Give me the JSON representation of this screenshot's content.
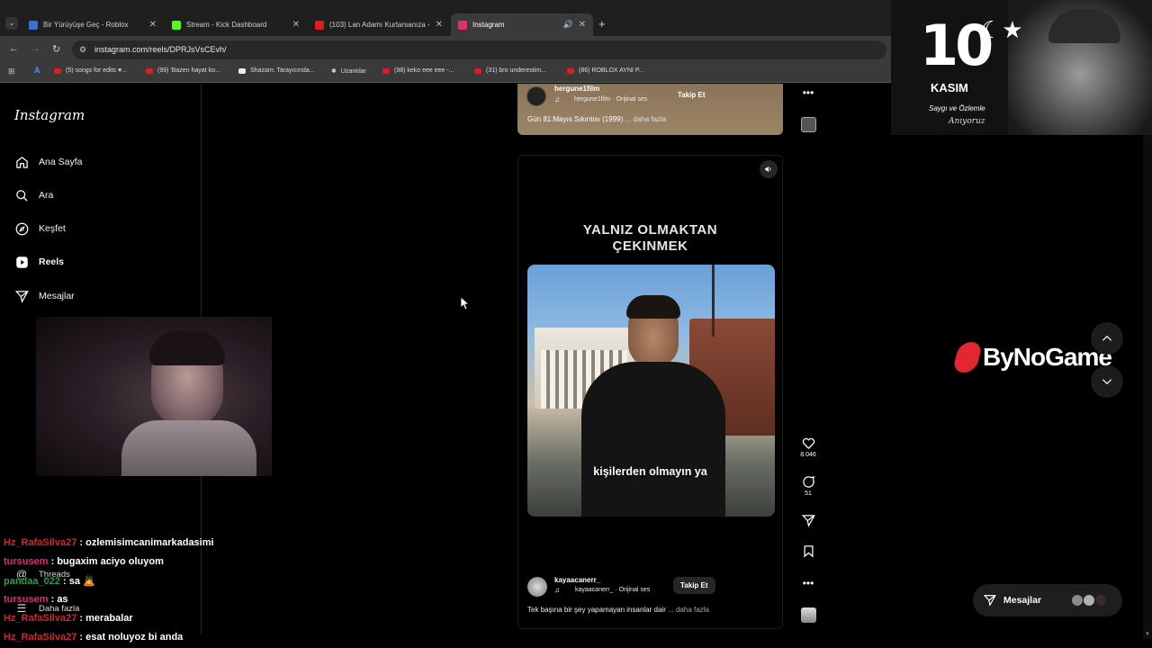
{
  "browser": {
    "tabs": [
      {
        "title": "Bir Yürüyüşe Geç - Roblox",
        "color": "#3b6fd6"
      },
      {
        "title": "Stream - Kick Dashboard",
        "color": "#53fc18"
      },
      {
        "title": "(103) Lan Adamı Kurtarsanıza -",
        "color": "#e01b24"
      },
      {
        "title": "Instagram",
        "color": "#e1306c"
      }
    ],
    "url": "instagram.com/reels/DPRJsVsCEvh/",
    "bookmarks": [
      "(5) songs for edits ♥...",
      "(99) 'Bazen hayat ko...",
      "Shazam: Tarayıcında...",
      "Uzantılar",
      "(98) keko eee eee -...",
      "(31) bro underestim...",
      "(86) ROBLOX AYNI P..."
    ]
  },
  "sidebar": {
    "logo": "Instagram",
    "items": [
      {
        "label": "Ana Sayfa",
        "icon": "home-icon"
      },
      {
        "label": "Ara",
        "icon": "search-icon"
      },
      {
        "label": "Keşfet",
        "icon": "compass-icon"
      },
      {
        "label": "Reels",
        "icon": "reels-icon"
      },
      {
        "label": "Mesajlar",
        "icon": "send-icon"
      }
    ],
    "bottom": [
      {
        "label": "Threads",
        "icon": "threads-icon"
      },
      {
        "label": "Daha fazla",
        "icon": "menu-icon"
      }
    ]
  },
  "reel_top": {
    "username": "hergune1film",
    "audio": "hergune1film · Orijinal ses",
    "follow": "Takip Et",
    "caption": "Gün 81:Mayıs Sıkıntısı (1999)",
    "more": "... daha fazla"
  },
  "reel_main": {
    "title_line1": "YALNIZ OLMAKTAN",
    "title_line2": "ÇEKINMEK",
    "subtitle": "kişilerden olmayın ya",
    "username": "kayaacanerr_",
    "audio": "kayaacanerr_ · Orijinal ses",
    "follow": "Takip Et",
    "caption": "Tek başına bir şey yapamayan insanlar dair",
    "more": "... daha fazla",
    "likes": "8.046",
    "comments": "51"
  },
  "overlay": {
    "kasim_number": "10",
    "kasim_word": "KASIM",
    "kasim_line": "Saygı ve Özlemle",
    "kasim_sign": "Anıyoruz",
    "brand": "ByNoGame",
    "messages_label": "Mesajlar"
  },
  "chat": [
    {
      "user": "Hz_RafaSilva27",
      "msg": ": ozlemisimcanimarkadasimi",
      "cls": "u1"
    },
    {
      "user": "tursusem",
      "msg": ": bugaxim aciyo oluyom",
      "cls": "u2"
    },
    {
      "user": "pandaa_022",
      "msg": ": sa 🙇",
      "cls": "u3"
    },
    {
      "user": "tursusem",
      "msg": ": as",
      "cls": "u2"
    },
    {
      "user": "Hz_RafaSilva27",
      "msg": ": merabalar",
      "cls": "u1"
    },
    {
      "user": "Hz_RafaSilva27",
      "msg": ": esat noluyoz bi anda",
      "cls": "u1"
    }
  ]
}
